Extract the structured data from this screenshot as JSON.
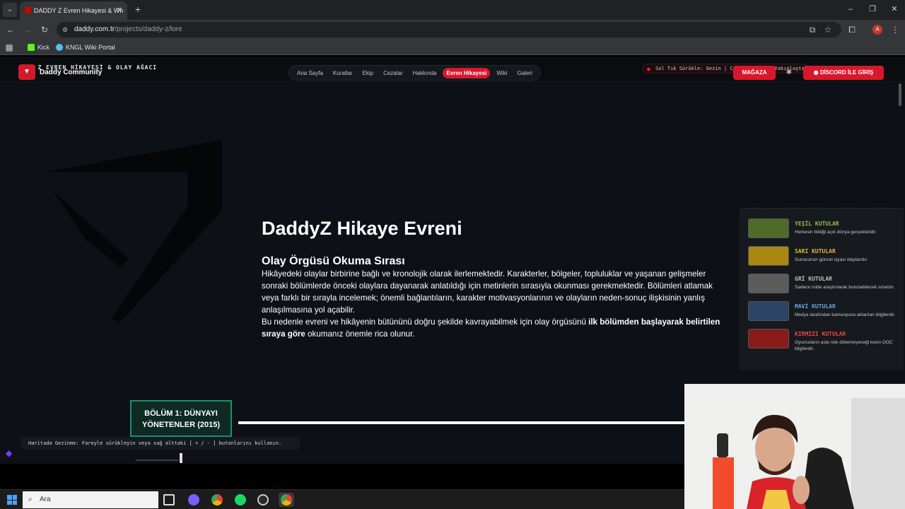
{
  "browser": {
    "tab_title": "DADDY Z Evren Hikayesi & Wh",
    "url_host": "daddy.com.tr",
    "url_path": "/projects/daddy-z/lore",
    "bookmarks": [
      {
        "label": "Kick",
        "color": "#53fc18"
      },
      {
        "label": "KNGL Wiki Portal",
        "color": "#4fc3f7"
      }
    ],
    "profile_initial": "A"
  },
  "site": {
    "title": "DY Z EVREN HİKAYESİ & OLAY AĞACI",
    "brand": "Daddy Community",
    "nav": [
      {
        "label": "Ana Sayfa",
        "active": false
      },
      {
        "label": "Kurallar",
        "active": false
      },
      {
        "label": "Ekip",
        "active": false
      },
      {
        "label": "Cezalar",
        "active": false
      },
      {
        "label": "Hakkında",
        "active": false
      },
      {
        "label": "Evren Hikayesi",
        "active": true
      },
      {
        "label": "Wiki",
        "active": false
      },
      {
        "label": "Galeri",
        "active": false
      }
    ],
    "hint": "Sol Tık Sürükle: Gezin | Ctrl+Tekerlek: Yakınlaştır",
    "store_button": "MAĞAZA",
    "discord_button": "DİSCORD İLE GİRİŞ"
  },
  "hero": {
    "title": "DaddyZ Hikaye Evreni",
    "subtitle": "Olay Örgüsü Okuma Sırası",
    "para1": "Hikâyedeki olaylar birbirine bağlı ve kronolojik olarak ilerlemektedir. Karakterler, bölgeler, topluluklar ve yaşanan gelişmeler sonraki bölümlerde önceki olaylara dayanarak anlatıldığı için metinlerin sırasıyla okunması gerekmektedir. Bölümleri atlamak veya farklı bir sırayla incelemek; önemli bağlantıların, karakter motivasyonlarının ve olayların neden-sonuç ilişkisinin yanlış anlaşılmasına yol açabilir.",
    "para2_pre": "Bu nedenle evreni ve hikâyenin bütününü doğru şekilde kavrayabilmek için olay örgüsünü ",
    "para2_bold": "ilk bölümden başlayarak belirtilen sıraya göre",
    "para2_post": " okumanız önemle rica olunur."
  },
  "legend": [
    {
      "title": "YEŞİL KUTULAR",
      "desc": "Herkesin bildiği açık dünya gerçekleridir.",
      "color": "#4f6b2a",
      "title_color": "#8fbf4a"
    },
    {
      "title": "SARI KUTULAR",
      "desc": "Sunucunun güncel siyasi olaylarıdır.",
      "color": "#a98512",
      "title_color": "#e0b637"
    },
    {
      "title": "GRİ KUTULAR",
      "desc": "Sadece rolde araştırılarak bulunabilecek sırlardır.",
      "color": "#5c5c5c",
      "title_color": "#bdbdbd"
    },
    {
      "title": "MAVİ KUTULAR",
      "desc": "Medya tarafından kamuoyuna aktarılan bilgilerdir.",
      "color": "#2c4466",
      "title_color": "#6aa3e0"
    },
    {
      "title": "KIRMIZI KUTULAR",
      "desc": "Oyuncuların asla role dökemeyeceği kesin OOC bilgilerdir.",
      "color": "#8a1b1b",
      "title_color": "#e24a4a"
    }
  ],
  "timeline": {
    "chapter1": "BÖLÜM 1: DÜNYAYI YÖNETENLER (2015)",
    "map_hint": "Haritada Gezinme: Fareyle sürükleyin veya sağ alttaki [ + / - ] butonlarını kullanın."
  },
  "taskbar": {
    "search_placeholder": "Ara",
    "apps": [
      {
        "name": "task-view",
        "color": "#dddddd"
      },
      {
        "name": "discord",
        "color": "#7a5cff"
      },
      {
        "name": "chrome",
        "color": "#f2b400"
      },
      {
        "name": "spotify",
        "color": "#1ed760"
      },
      {
        "name": "obs",
        "color": "#cccccc"
      },
      {
        "name": "chrome-active",
        "color": "#e94235"
      }
    ]
  }
}
